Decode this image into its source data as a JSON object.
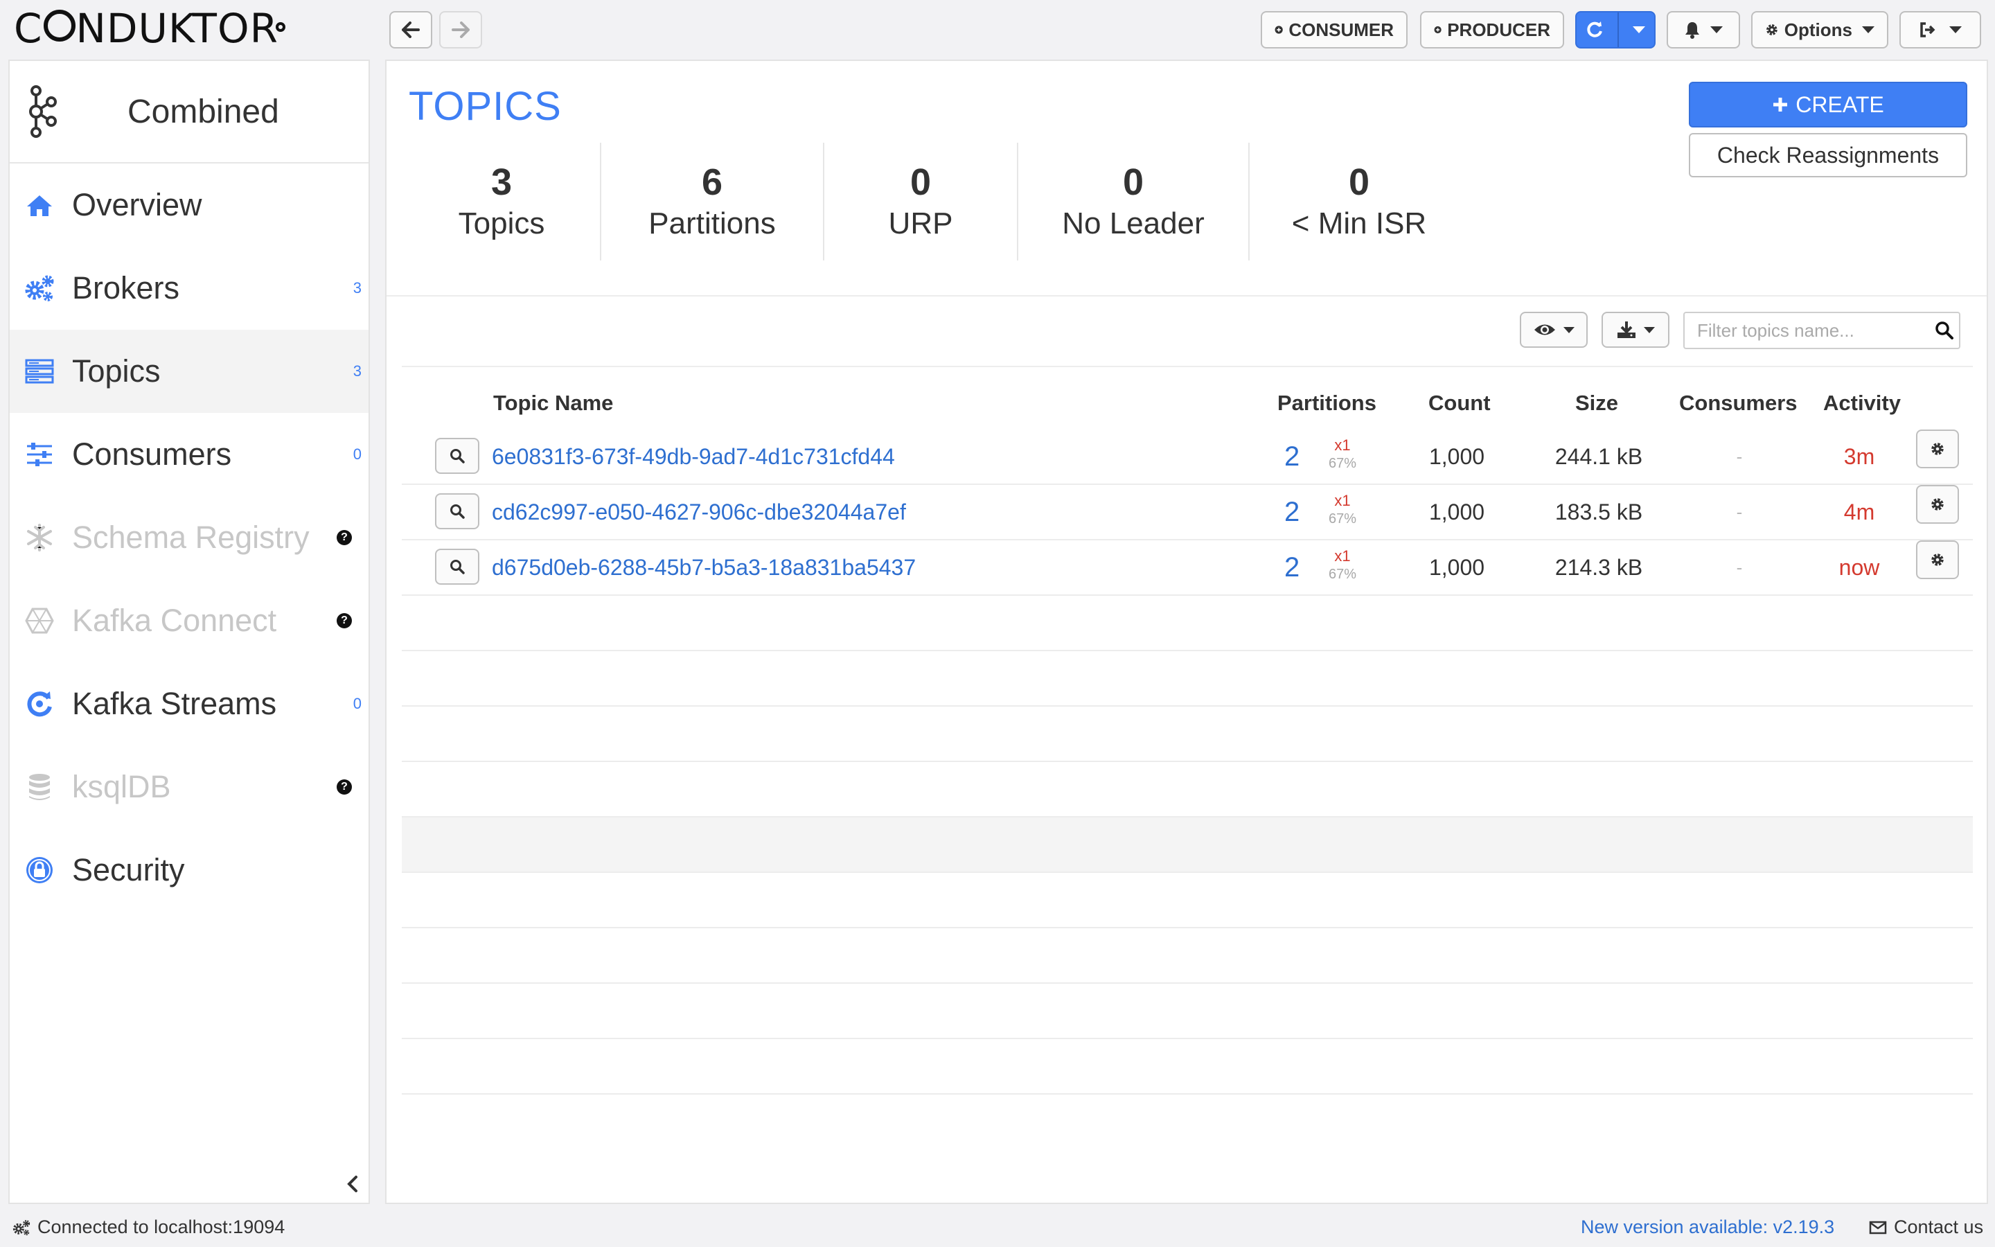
{
  "brand": {
    "logo_text_1": "C",
    "logo_text_2": "NDUKTOR"
  },
  "toolbar": {
    "consumer_label": "CONSUMER",
    "producer_label": "PRODUCER",
    "options_label": "Options"
  },
  "sidebar": {
    "cluster_name": "Combined",
    "items": [
      {
        "label": "Overview",
        "count": "",
        "icon": "home-icon",
        "state": "normal"
      },
      {
        "label": "Brokers",
        "count": "3",
        "icon": "cogs-icon",
        "state": "normal"
      },
      {
        "label": "Topics",
        "count": "3",
        "icon": "server-icon",
        "state": "active"
      },
      {
        "label": "Consumers",
        "count": "0",
        "icon": "sliders-icon",
        "state": "normal"
      },
      {
        "label": "Schema Registry",
        "count": "",
        "icon": "snowflake-icon",
        "state": "disabled"
      },
      {
        "label": "Kafka Connect",
        "count": "",
        "icon": "hexagon-icon",
        "state": "disabled"
      },
      {
        "label": "Kafka Streams",
        "count": "0",
        "icon": "refresh-icon",
        "state": "normal"
      },
      {
        "label": "ksqlDB",
        "count": "",
        "icon": "database-icon",
        "state": "disabled"
      },
      {
        "label": "Security",
        "count": "",
        "icon": "lock-icon",
        "state": "normal"
      }
    ],
    "help_glyph": "?"
  },
  "main": {
    "title": "TOPICS",
    "create_label": "CREATE",
    "reassign_label": "Check Reassignments",
    "stats": [
      {
        "value": "3",
        "label": "Topics"
      },
      {
        "value": "6",
        "label": "Partitions"
      },
      {
        "value": "0",
        "label": "URP"
      },
      {
        "value": "0",
        "label": "No Leader"
      },
      {
        "value": "0",
        "label": "< Min ISR"
      }
    ],
    "filter_placeholder": "Filter topics name...",
    "columns": {
      "name": "Topic Name",
      "partitions": "Partitions",
      "count": "Count",
      "size": "Size",
      "consumers": "Consumers",
      "activity": "Activity"
    },
    "rows": [
      {
        "name": "6e0831f3-673f-49db-9ad7-4d1c731cfd44",
        "partitions": "2",
        "replication": "x1",
        "pct": "67%",
        "count": "1,000",
        "size": "244.1 kB",
        "consumers": "-",
        "activity": "3m"
      },
      {
        "name": "cd62c997-e050-4627-906c-dbe32044a7ef",
        "partitions": "2",
        "replication": "x1",
        "pct": "67%",
        "count": "1,000",
        "size": "183.5 kB",
        "consumers": "-",
        "activity": "4m"
      },
      {
        "name": "d675d0eb-6288-45b7-b5a3-18a831ba5437",
        "partitions": "2",
        "replication": "x1",
        "pct": "67%",
        "count": "1,000",
        "size": "214.3 kB",
        "consumers": "-",
        "activity": "now"
      }
    ]
  },
  "status": {
    "connection": "Connected to localhost:19094",
    "version": "New version available: v2.19.3",
    "contact": "Contact us"
  },
  "colors": {
    "accent": "#3f7ff4",
    "link": "#2e6fd0",
    "alert": "#d43a2f"
  }
}
